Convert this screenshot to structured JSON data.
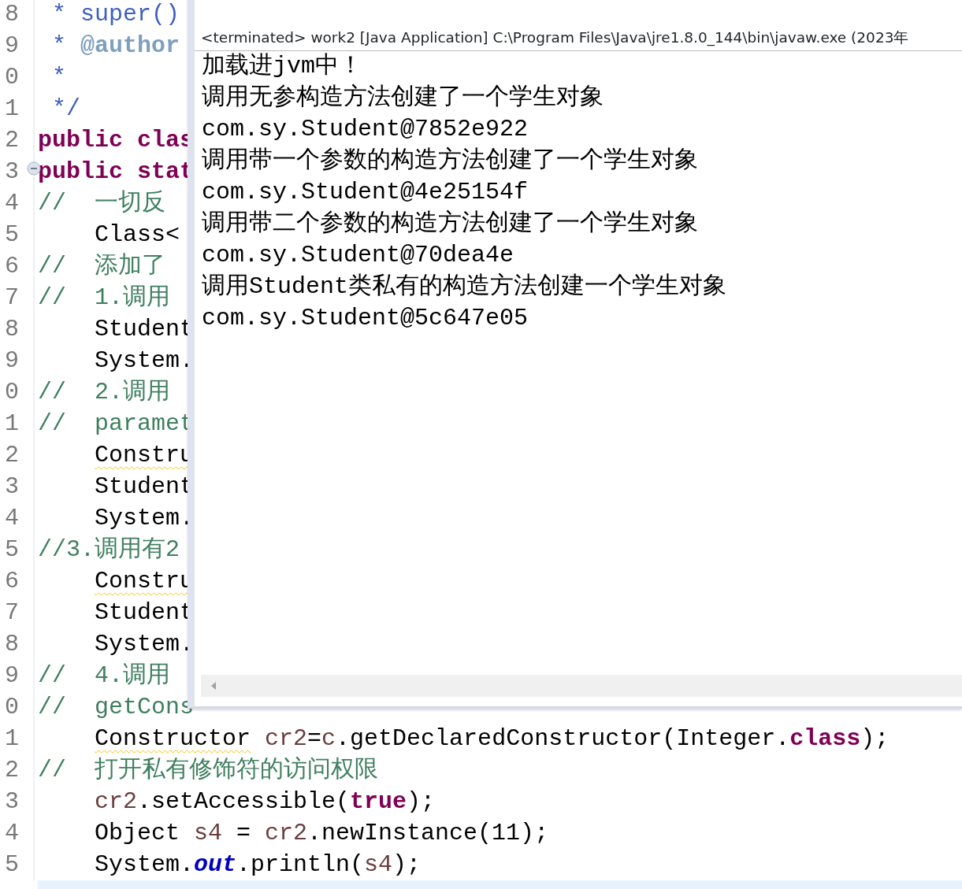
{
  "editor": {
    "lines": [
      {
        "number": "8",
        "fold": false,
        "tokens": [
          {
            "kind": "javadoc",
            "text": " * super()"
          }
        ]
      },
      {
        "number": "9",
        "fold": false,
        "tokens": [
          {
            "kind": "javadoc",
            "text": " * "
          },
          {
            "kind": "tag",
            "text": "@author"
          }
        ]
      },
      {
        "number": "0",
        "fold": false,
        "tokens": [
          {
            "kind": "javadoc",
            "text": " *"
          }
        ]
      },
      {
        "number": "1",
        "fold": false,
        "tokens": [
          {
            "kind": "javadoc",
            "text": " */"
          }
        ]
      },
      {
        "number": "2",
        "fold": false,
        "tokens": [
          {
            "kind": "keyword",
            "text": "public clas"
          }
        ]
      },
      {
        "number": "3",
        "fold": true,
        "tokens": [
          {
            "kind": "keyword",
            "text": "public stat"
          }
        ]
      },
      {
        "number": "4",
        "fold": false,
        "tokens": [
          {
            "kind": "comment",
            "text": "//  一切反"
          }
        ]
      },
      {
        "number": "5",
        "fold": false,
        "tokens": [
          {
            "kind": "indented",
            "text": "Class<"
          }
        ]
      },
      {
        "number": "6",
        "fold": false,
        "tokens": [
          {
            "kind": "comment",
            "text": "//  添加了"
          }
        ]
      },
      {
        "number": "7",
        "fold": false,
        "tokens": [
          {
            "kind": "comment",
            "text": "//  1.调用"
          }
        ]
      },
      {
        "number": "8",
        "fold": false,
        "tokens": [
          {
            "kind": "indented",
            "text": "Student"
          }
        ]
      },
      {
        "number": "9",
        "fold": false,
        "tokens": [
          {
            "kind": "indented",
            "text": "System."
          }
        ]
      },
      {
        "number": "0",
        "fold": false,
        "tokens": [
          {
            "kind": "comment",
            "text": "//  2.调用"
          }
        ]
      },
      {
        "number": "1",
        "fold": false,
        "tokens": [
          {
            "kind": "comment",
            "text": "//  paramet"
          }
        ]
      },
      {
        "number": "2",
        "fold": false,
        "tokens": [
          {
            "kind": "warning",
            "text": "Constru"
          }
        ]
      },
      {
        "number": "3",
        "fold": false,
        "tokens": [
          {
            "kind": "indented",
            "text": "Student"
          }
        ]
      },
      {
        "number": "4",
        "fold": false,
        "tokens": [
          {
            "kind": "indented",
            "text": "System."
          }
        ]
      },
      {
        "number": "5",
        "fold": false,
        "tokens": [
          {
            "kind": "comment",
            "text": "//3.调用有2"
          }
        ]
      },
      {
        "number": "6",
        "fold": false,
        "tokens": [
          {
            "kind": "warning",
            "text": "Constru"
          }
        ]
      },
      {
        "number": "7",
        "fold": false,
        "tokens": [
          {
            "kind": "indented",
            "text": "Student"
          }
        ]
      },
      {
        "number": "8",
        "fold": false,
        "tokens": [
          {
            "kind": "indented",
            "text": "System."
          }
        ]
      },
      {
        "number": "9",
        "fold": false,
        "tokens": [
          {
            "kind": "comment",
            "text": "//  4.调用"
          }
        ]
      },
      {
        "number": "0",
        "fold": false,
        "tokens": [
          {
            "kind": "comment",
            "text": "//  getCons"
          }
        ]
      },
      {
        "number": "1",
        "fold": false,
        "tokens": [
          {
            "kind": "warning",
            "text": "Constructor"
          },
          {
            "kind": "local",
            "text": " cr2"
          },
          {
            "kind": "plain",
            "text": "="
          },
          {
            "kind": "local",
            "text": "c"
          },
          {
            "kind": "plain",
            "text": ".getDeclaredConstructor(Integer."
          },
          {
            "kind": "keyword",
            "text": "class"
          },
          {
            "kind": "plain",
            "text": ");"
          }
        ]
      },
      {
        "number": "2",
        "fold": false,
        "tokens": [
          {
            "kind": "comment",
            "text": "//  打开私有修饰符的访问权限"
          }
        ]
      },
      {
        "number": "3",
        "fold": false,
        "tokens": [
          {
            "kind": "local_indented",
            "text": "cr2"
          },
          {
            "kind": "plain",
            "text": ".setAccessible("
          },
          {
            "kind": "keyword",
            "text": "true"
          },
          {
            "kind": "plain",
            "text": ");"
          }
        ]
      },
      {
        "number": "4",
        "fold": false,
        "tokens": [
          {
            "kind": "indented",
            "text": "Object "
          },
          {
            "kind": "local",
            "text": "s4"
          },
          {
            "kind": "plain",
            "text": " = "
          },
          {
            "kind": "local",
            "text": "cr2"
          },
          {
            "kind": "plain",
            "text": ".newInstance(11);"
          }
        ]
      },
      {
        "number": "5",
        "fold": false,
        "tokens": [
          {
            "kind": "indented",
            "text": "System."
          },
          {
            "kind": "field",
            "text": "out"
          },
          {
            "kind": "plain",
            "text": ".println("
          },
          {
            "kind": "local",
            "text": "s4"
          },
          {
            "kind": "plain",
            "text": ");"
          }
        ]
      }
    ]
  },
  "console": {
    "header": "<terminated> work2 [Java Application] C:\\Program Files\\Java\\jre1.8.0_144\\bin\\javaw.exe (2023年",
    "output": [
      "加载进jvm中！",
      "调用无参构造方法创建了一个学生对象",
      "com.sy.Student@7852e922",
      "调用带一个参数的构造方法创建了一个学生对象",
      "com.sy.Student@4e25154f",
      "调用带二个参数的构造方法创建了一个学生对象",
      "com.sy.Student@70dea4e",
      "调用Student类私有的构造方法创建一个学生对象",
      "com.sy.Student@5c647e05"
    ]
  }
}
